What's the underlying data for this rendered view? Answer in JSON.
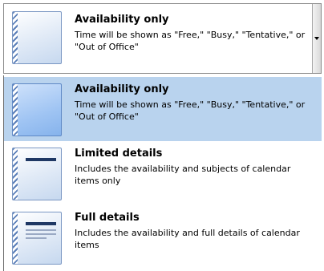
{
  "combo": {
    "title": "Availability only",
    "description": "Time will be shown as \"Free,\" \"Busy,\" \"Tentative,\" or \"Out of Office\""
  },
  "options": [
    {
      "title": "Availability only",
      "description": "Time will be shown as \"Free,\" \"Busy,\" \"Tentative,\" or \"Out of Office\"",
      "selected": true
    },
    {
      "title": "Limited details",
      "description": "Includes the availability and subjects of calendar items only",
      "selected": false
    },
    {
      "title": "Full details",
      "description": "Includes the availability and full details of calendar items",
      "selected": false
    }
  ],
  "icons": {
    "availability": "availability-only-icon",
    "limited": "limited-details-icon",
    "full": "full-details-icon",
    "dropdown": "chevron-down-icon"
  },
  "colors": {
    "selected_background": "#b9d3ee",
    "accent": "#1f3864"
  }
}
